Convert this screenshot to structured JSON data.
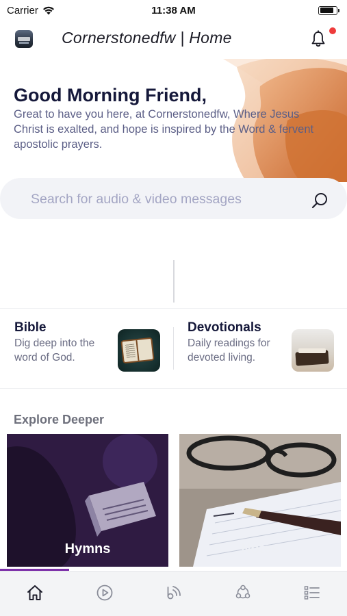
{
  "status_bar": {
    "carrier": "Carrier",
    "time": "11:38 AM",
    "battery_level": 0.85
  },
  "header": {
    "title": "Cornerstonedfw | Home",
    "notification_dot": true
  },
  "hero": {
    "greeting": "Good Morning Friend,",
    "text": "Great to have you here, at Cornerstonedfw, Where Jesus Christ is exalted, and hope is inspired by the Word & fervent apostolic prayers."
  },
  "search": {
    "placeholder": "Search for audio & video messages"
  },
  "cards": [
    {
      "title": "Bible",
      "desc": "Dig deep into the word of God."
    },
    {
      "title": "Devotionals",
      "desc": "Daily readings for devoted living."
    }
  ],
  "explore": {
    "title": "Explore Deeper",
    "tiles": [
      {
        "label": "Hymns"
      },
      {
        "label": "Notes"
      }
    ]
  },
  "player": {
    "progress": 0.2
  },
  "bottom_nav": {
    "items": [
      {
        "icon": "home-icon",
        "active": true
      },
      {
        "icon": "play-icon",
        "active": false
      },
      {
        "icon": "podcast-icon",
        "active": false
      },
      {
        "icon": "community-icon",
        "active": false
      },
      {
        "icon": "list-icon",
        "active": false
      }
    ]
  },
  "colors": {
    "accent": "#7c2fa8",
    "brand_orange": "#d87a3e",
    "heading": "#15183a",
    "notification": "#ee3b3b"
  }
}
